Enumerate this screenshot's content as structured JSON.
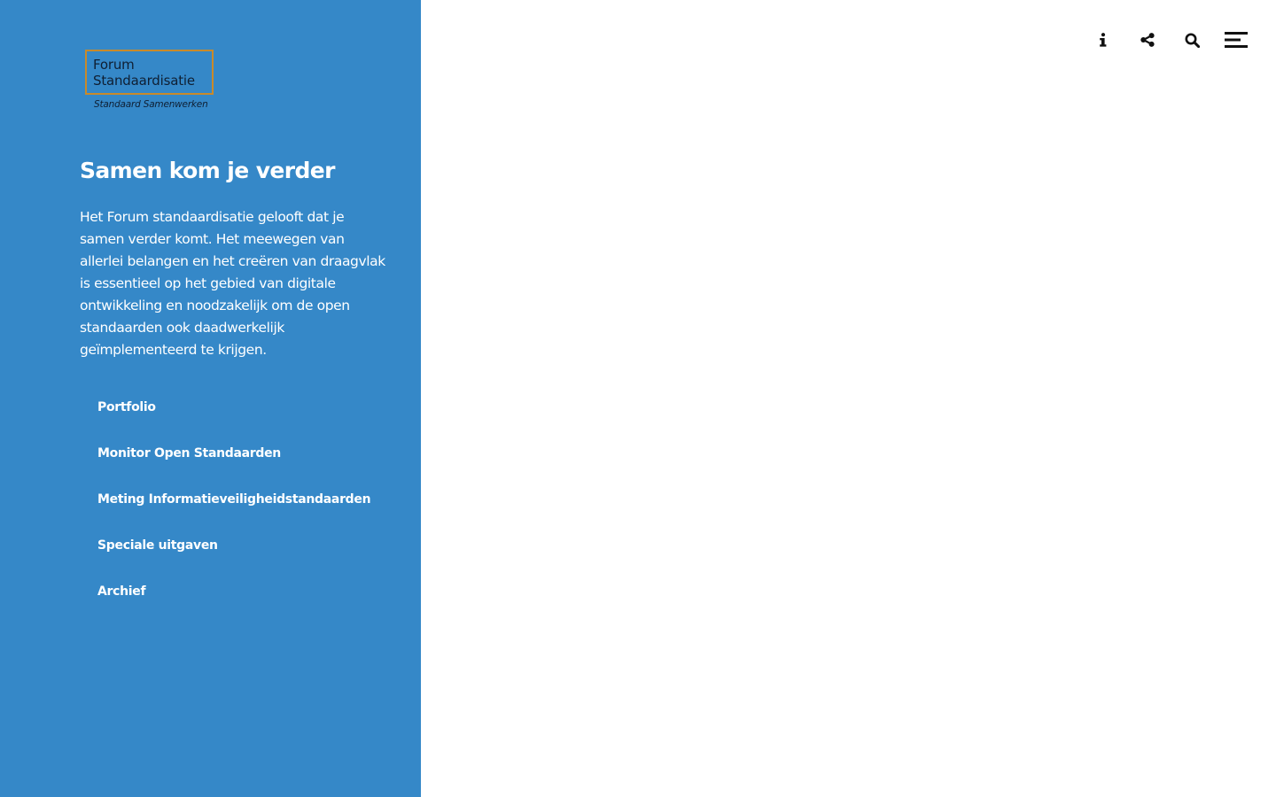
{
  "logo": {
    "line1": "Forum",
    "line2": "Standaardisatie",
    "tagline": "Standaard Samenwerken"
  },
  "intro": {
    "title": "Samen kom je verder",
    "text": "Het Forum standaardisatie gelooft dat je samen verder komt. Het meewegen van allerlei belangen en het creëren van draagvlak is essentieel op het gebied van digitale ontwikkeling en noodzakelijk om de open standaarden ook daadwerkelijk geïmplementeerd te krijgen."
  },
  "sidebar": {
    "items": [
      {
        "label": "Portfolio"
      },
      {
        "label": "Monitor Open Standaarden"
      },
      {
        "label": "Meting Informatieveiligheidstandaarden"
      },
      {
        "label": "Speciale uitgaven"
      },
      {
        "label": "Archief"
      }
    ]
  },
  "toolbar": {
    "icons": [
      "info-icon",
      "share-icon",
      "search-icon",
      "menu-icon"
    ]
  },
  "colors": {
    "sidebar_bg": "#3588c8",
    "logo_border": "#c98a2a",
    "text_light": "#ffffff",
    "icon_dark": "#111111"
  }
}
